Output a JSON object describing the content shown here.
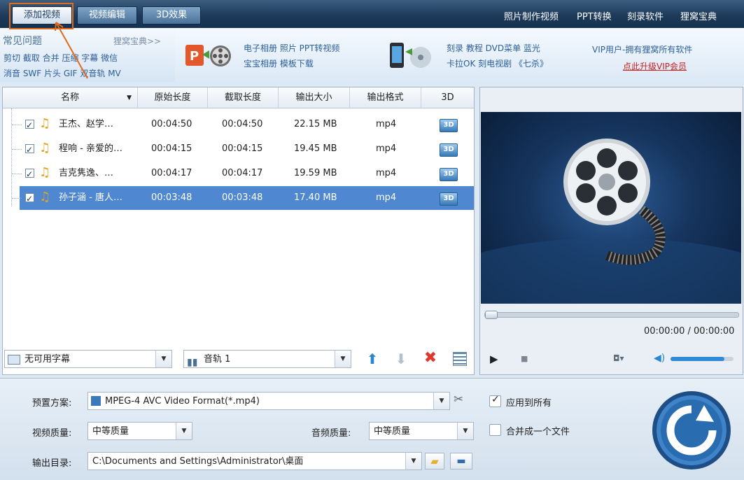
{
  "toolbar": {
    "tabs": [
      "添加视频",
      "视频编辑",
      "3D效果"
    ],
    "links": [
      "照片制作视频",
      "PPT转换",
      "刻录软件",
      "狸窝宝典"
    ]
  },
  "faq": {
    "title": "常见问题",
    "more": "狸窝宝典>>",
    "line1": "剪切 截取 合并 压缩 字幕 微信",
    "line2": "消音 SWF 片头 GIF 双音轨 MV"
  },
  "promo": {
    "a_line1": "电子相册 照片 PPT转视频",
    "a_line2": "宝宝相册 模板下载",
    "b_line1": "刻录 教程 DVD菜单 蓝光",
    "b_line2": "卡拉OK 刻电视剧 《七杀》",
    "vip_line1": "VIP用户-拥有狸窝所有软件",
    "vip_line2": "点此升级VIP会员"
  },
  "table": {
    "columns": [
      "名称",
      "原始长度",
      "截取长度",
      "输出大小",
      "输出格式",
      "3D"
    ],
    "rows": [
      {
        "name": "王杰、赵学…",
        "orig": "00:04:50",
        "cut": "00:04:50",
        "size": "22.15 MB",
        "fmt": "mp4",
        "selected": false
      },
      {
        "name": "程响 - 亲爱的…",
        "orig": "00:04:15",
        "cut": "00:04:15",
        "size": "19.45 MB",
        "fmt": "mp4",
        "selected": false
      },
      {
        "name": "吉克隽逸、…",
        "orig": "00:04:17",
        "cut": "00:04:17",
        "size": "19.59 MB",
        "fmt": "mp4",
        "selected": false
      },
      {
        "name": "孙子涵 - 唐人…",
        "orig": "00:03:48",
        "cut": "00:03:48",
        "size": "17.40 MB",
        "fmt": "mp4",
        "selected": true
      }
    ],
    "badge_3d": "3D"
  },
  "subtitle_select": "无可用字幕",
  "audio_select": "音轨 1",
  "player": {
    "time": "00:00:00 / 00:00:00",
    "progress": 0,
    "volume": 0.85
  },
  "settings": {
    "preset_label": "预置方案:",
    "preset_value": "MPEG-4 AVC Video Format(*.mp4)",
    "apply_all": "应用到所有",
    "apply_all_checked": true,
    "video_quality_label": "视频质量:",
    "video_quality": "中等质量",
    "audio_quality_label": "音频质量:",
    "audio_quality": "中等质量",
    "merge": "合并成一个文件",
    "merge_checked": false,
    "output_label": "输出目录:",
    "output_path": "C:\\Documents and Settings\\Administrator\\桌面"
  },
  "colors": {
    "accent": "#4f88d0",
    "highlight": "#e06b1c",
    "link": "#2c5f98",
    "vip_link": "#c8201e"
  }
}
